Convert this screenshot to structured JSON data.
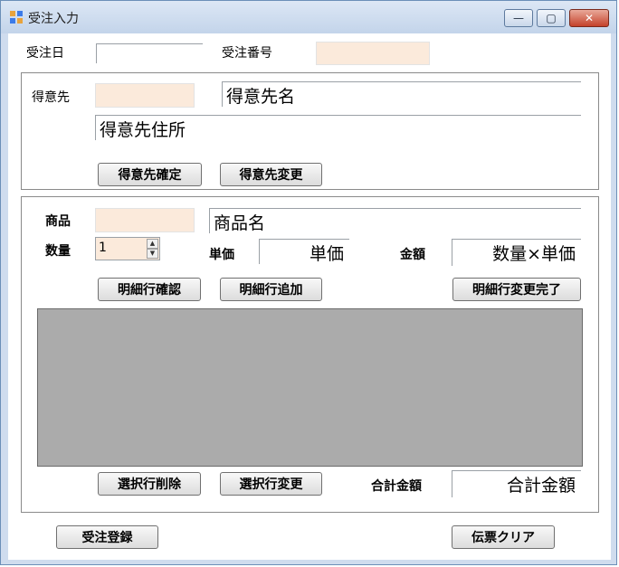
{
  "window": {
    "title": "受注入力",
    "minimize_glyph": "—",
    "maximize_glyph": "▢",
    "close_glyph": "✕"
  },
  "header": {
    "order_date_label": "受注日",
    "order_date_value": "",
    "order_number_label": "受注番号",
    "order_number_value": ""
  },
  "customer": {
    "label": "得意先",
    "code_value": "",
    "name_value": "得意先名",
    "address_value": "得意先住所",
    "confirm_button": "得意先確定",
    "change_button": "得意先変更"
  },
  "detail": {
    "product_label": "商品",
    "product_code_value": "",
    "product_name_value": "商品名",
    "quantity_label": "数量",
    "quantity_value": "1",
    "unit_price_label": "単価",
    "unit_price_value": "単価",
    "amount_label": "金額",
    "amount_value": "数量×単価",
    "confirm_line_button": "明細行確認",
    "add_line_button": "明細行追加",
    "change_complete_button": "明細行変更完了",
    "delete_selected_button": "選択行削除",
    "change_selected_button": "選択行変更",
    "total_label": "合計金額",
    "total_value": "合計金額"
  },
  "footer": {
    "register_button": "受注登録",
    "clear_button": "伝票クリア"
  }
}
